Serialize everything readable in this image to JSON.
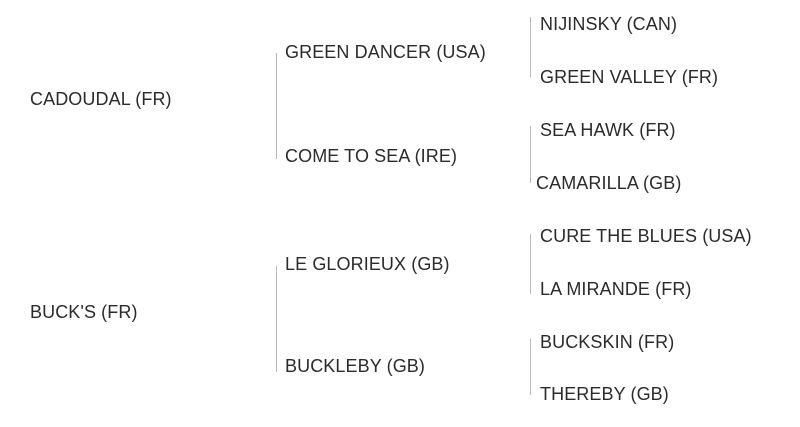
{
  "pedigree": {
    "sire": {
      "name": "CADOUDAL (FR)",
      "sire": {
        "name": "GREEN DANCER (USA)",
        "sire": "NIJINSKY (CAN)",
        "dam": "GREEN VALLEY (FR)"
      },
      "dam": {
        "name": "COME TO SEA (IRE)",
        "sire": "SEA HAWK (FR)",
        "dam": "CAMARILLA (GB)"
      }
    },
    "dam": {
      "name": "BUCK'S (FR)",
      "sire": {
        "name": "LE GLORIEUX (GB)",
        "sire": "CURE THE BLUES (USA)",
        "dam": "LA MIRANDE (FR)"
      },
      "dam": {
        "name": "BUCKLEBY (GB)",
        "sire": "BUCKSKIN (FR)",
        "dam": "THEREBY (GB)"
      }
    }
  },
  "colors": {
    "text": "#2b2b2b",
    "connector": "#b9b9b9",
    "background": "#ffffff"
  }
}
